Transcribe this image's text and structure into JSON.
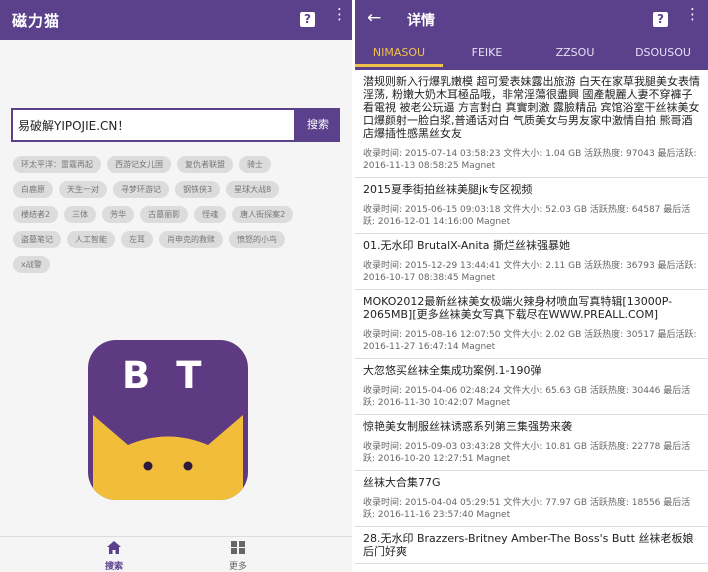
{
  "left": {
    "app_title": "磁力猫",
    "help_glyph": "?",
    "more_glyph": "⋮",
    "search": {
      "value": "易破解YIPOJIE.CN！",
      "button_label": "搜索"
    },
    "tags": [
      [
        "环太平洋：雷霆再起",
        "西游记女儿国",
        "复仇者联盟",
        "骑士"
      ],
      [
        "白鹿原",
        "天生一对",
        "寻梦环游记",
        "钢铁侠3",
        "星球大战8"
      ],
      [
        "楼结者2",
        "三体",
        "芳华",
        "古墓丽影",
        "怪魂",
        "唐人街探案2"
      ],
      [
        "盗墓笔记",
        "人工智能",
        "左耳",
        "肖申克的救赎",
        "愤怒的小鸟"
      ],
      [
        "x战警"
      ]
    ],
    "logo_text": "BT",
    "nav": [
      {
        "label": "搜索",
        "icon": "home-icon"
      },
      {
        "label": "更多",
        "icon": "grid-icon"
      }
    ]
  },
  "right": {
    "title": "详情",
    "back_glyph": "←",
    "help_glyph": "?",
    "more_glyph": "⋮",
    "tabs": [
      "NIMASOU",
      "FEIKE",
      "ZZSOU",
      "DSOUSOU"
    ],
    "active_tab": 0,
    "results": [
      {
        "title": "潜规则新入行爆乳嫩模 超可爱表妹露出旅游 白天在家草我腿美女表情淫荡, 粉嫩大奶木耳極品哦，非常淫蕩很盡興 國產靚麗人妻不穿褲子看電視 被老公玩逼 方言對白 真實刺激 露臉精品 宾馆浴室干丝袜美女口爆颜射一脸白浆,普通话对白 气质美女与男友家中激情自拍 熊哥酒店爆插性感黑丝女友",
        "meta": "收录时间: 2015-07-14 03:58:23 文件大小: 1.04 GB 活跃热度: 97043 最后活跃: 2016-11-13 08:58:25 Magnet"
      },
      {
        "title": "2015夏季街拍丝袜美腿jk专区视频",
        "meta": "收录时间: 2015-06-15 09:03:18 文件大小: 52.03 GB 活跃热度: 64587 最后活跃: 2016-12-01 14:16:00 Magnet"
      },
      {
        "title": "01.无水印 BrutalX-Anita 撕烂丝袜强暴她",
        "meta": "收录时间: 2015-12-29 13:44:41 文件大小: 2.11 GB 活跃热度: 36793 最后活跃: 2016-10-17 08:38:45 Magnet"
      },
      {
        "title": "MOKO2012最新丝袜美女极端火辣身材喷血写真特辑[13000P-2065MB][更多丝袜美女写真下载尽在WWW.PREALL.COM]",
        "meta": "收录时间: 2015-08-16 12:07:50 文件大小: 2.02 GB 活跃热度: 30517 最后活跃: 2016-11-27 16:47:14 Magnet"
      },
      {
        "title": "大忽悠买丝袜全集成功案例.1-190弹",
        "meta": "收录时间: 2015-04-06 02:48:24 文件大小: 65.63 GB 活跃热度: 30446 最后活跃: 2016-11-30 10:42:07 Magnet"
      },
      {
        "title": "惊艳美女制服丝袜诱惑系列第三集强势来袭",
        "meta": "收录时间: 2015-09-03 03:43:28 文件大小: 10.81 GB 活跃热度: 22778 最后活跃: 2016-10-20 12:27:51 Magnet"
      },
      {
        "title": "丝袜大合集77G",
        "meta": "收录时间: 2015-04-04 05:29:51 文件大小: 77.97 GB 活跃热度: 18556 最后活跃: 2016-11-16 23:57:40 Magnet"
      },
      {
        "title": "28.无水印 Brazzers-Britney Amber-The Boss's Butt 丝袜老板娘后门好爽",
        "meta": ""
      }
    ]
  },
  "colors": {
    "primary": "#5b418c",
    "accent": "#f0c24a",
    "logo_cat": "#f2bd3a",
    "logo_bg": "#5e3a82"
  }
}
